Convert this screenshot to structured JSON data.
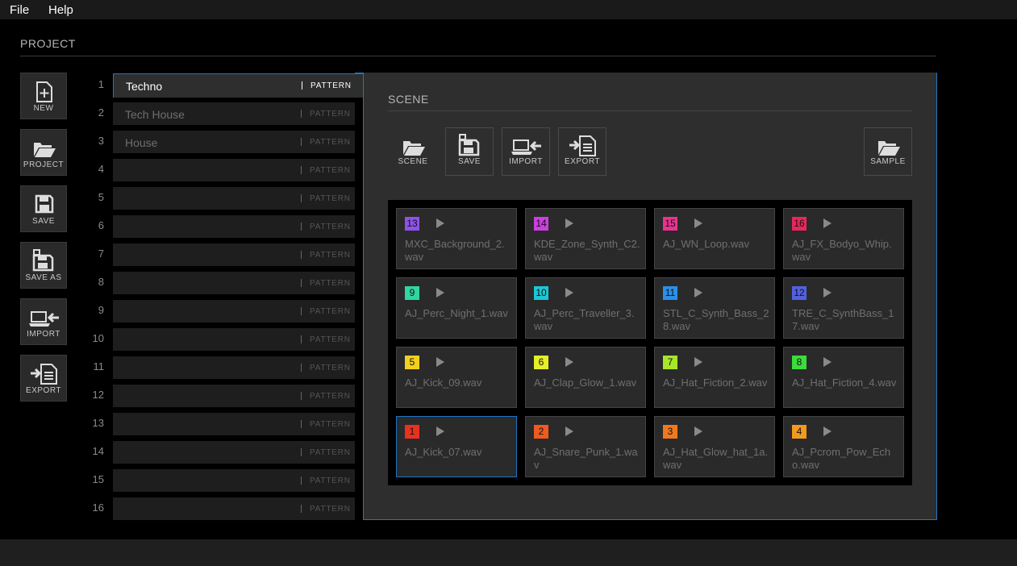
{
  "menu": {
    "file": "File",
    "help": "Help"
  },
  "project": {
    "title": "PROJECT",
    "tools": [
      {
        "label": "NEW",
        "icon": "new-file-icon"
      },
      {
        "label": "PROJECT",
        "icon": "folder-open-icon"
      },
      {
        "label": "SAVE",
        "icon": "save-icon"
      },
      {
        "label": "SAVE AS",
        "icon": "save-as-icon"
      },
      {
        "label": "IMPORT",
        "icon": "import-icon"
      },
      {
        "label": "EXPORT",
        "icon": "export-icon"
      }
    ],
    "patterns": [
      {
        "num": "1",
        "name": "Techno",
        "tag": "PATTERN"
      },
      {
        "num": "2",
        "name": "Tech House",
        "tag": "PATTERN"
      },
      {
        "num": "3",
        "name": "House",
        "tag": "PATTERN"
      },
      {
        "num": "4",
        "name": "",
        "tag": "PATTERN"
      },
      {
        "num": "5",
        "name": "",
        "tag": "PATTERN"
      },
      {
        "num": "6",
        "name": "",
        "tag": "PATTERN"
      },
      {
        "num": "7",
        "name": "",
        "tag": "PATTERN"
      },
      {
        "num": "8",
        "name": "",
        "tag": "PATTERN"
      },
      {
        "num": "9",
        "name": "",
        "tag": "PATTERN"
      },
      {
        "num": "10",
        "name": "",
        "tag": "PATTERN"
      },
      {
        "num": "11",
        "name": "",
        "tag": "PATTERN"
      },
      {
        "num": "12",
        "name": "",
        "tag": "PATTERN"
      },
      {
        "num": "13",
        "name": "",
        "tag": "PATTERN"
      },
      {
        "num": "14",
        "name": "",
        "tag": "PATTERN"
      },
      {
        "num": "15",
        "name": "",
        "tag": "PATTERN"
      },
      {
        "num": "16",
        "name": "",
        "tag": "PATTERN"
      }
    ]
  },
  "scene": {
    "title": "SCENE",
    "buttons": [
      {
        "label": "SCENE",
        "icon": "folder-open-icon"
      },
      {
        "label": "SAVE",
        "icon": "save-icon"
      },
      {
        "label": "IMPORT",
        "icon": "import-icon"
      },
      {
        "label": "EXPORT",
        "icon": "export-icon"
      }
    ],
    "sample_button": {
      "label": "SAMPLE",
      "icon": "folder-open-icon"
    },
    "pads": [
      {
        "num": "13",
        "color": "#8f52e8",
        "file": "MXC_Background_2.wav"
      },
      {
        "num": "14",
        "color": "#cc3fe0",
        "file": "KDE_Zone_Synth_C2.wav"
      },
      {
        "num": "15",
        "color": "#e8338f",
        "file": "AJ_WN_Loop.wav"
      },
      {
        "num": "16",
        "color": "#e8265e",
        "file": "AJ_FX_Bodyo_Whip.wav"
      },
      {
        "num": "9",
        "color": "#2fd6a0",
        "file": "AJ_Perc_Night_1.wav"
      },
      {
        "num": "10",
        "color": "#1bc6d6",
        "file": "AJ_Perc_Traveller_3.wav"
      },
      {
        "num": "11",
        "color": "#2a8fe8",
        "file": "STL_C_Synth_Bass_28.wav"
      },
      {
        "num": "12",
        "color": "#5361e0",
        "file": "TRE_C_SynthBass_17.wav"
      },
      {
        "num": "5",
        "color": "#f2d01f",
        "file": "AJ_Kick_09.wav"
      },
      {
        "num": "6",
        "color": "#e5f02a",
        "file": "AJ_Clap_Glow_1.wav"
      },
      {
        "num": "7",
        "color": "#a8e629",
        "file": "AJ_Hat_Fiction_2.wav"
      },
      {
        "num": "8",
        "color": "#3bdc3b",
        "file": "AJ_Hat_Fiction_4.wav"
      },
      {
        "num": "1",
        "color": "#e8321f",
        "file": "AJ_Kick_07.wav",
        "selected": true
      },
      {
        "num": "2",
        "color": "#ee5a1f",
        "file": "AJ_Snare_Punk_1.wav"
      },
      {
        "num": "3",
        "color": "#f0781f",
        "file": "AJ_Hat_Glow_hat_1a.wav"
      },
      {
        "num": "4",
        "color": "#f29a1f",
        "file": "AJ_Pcrom_Pow_Echo.wav"
      }
    ]
  }
}
